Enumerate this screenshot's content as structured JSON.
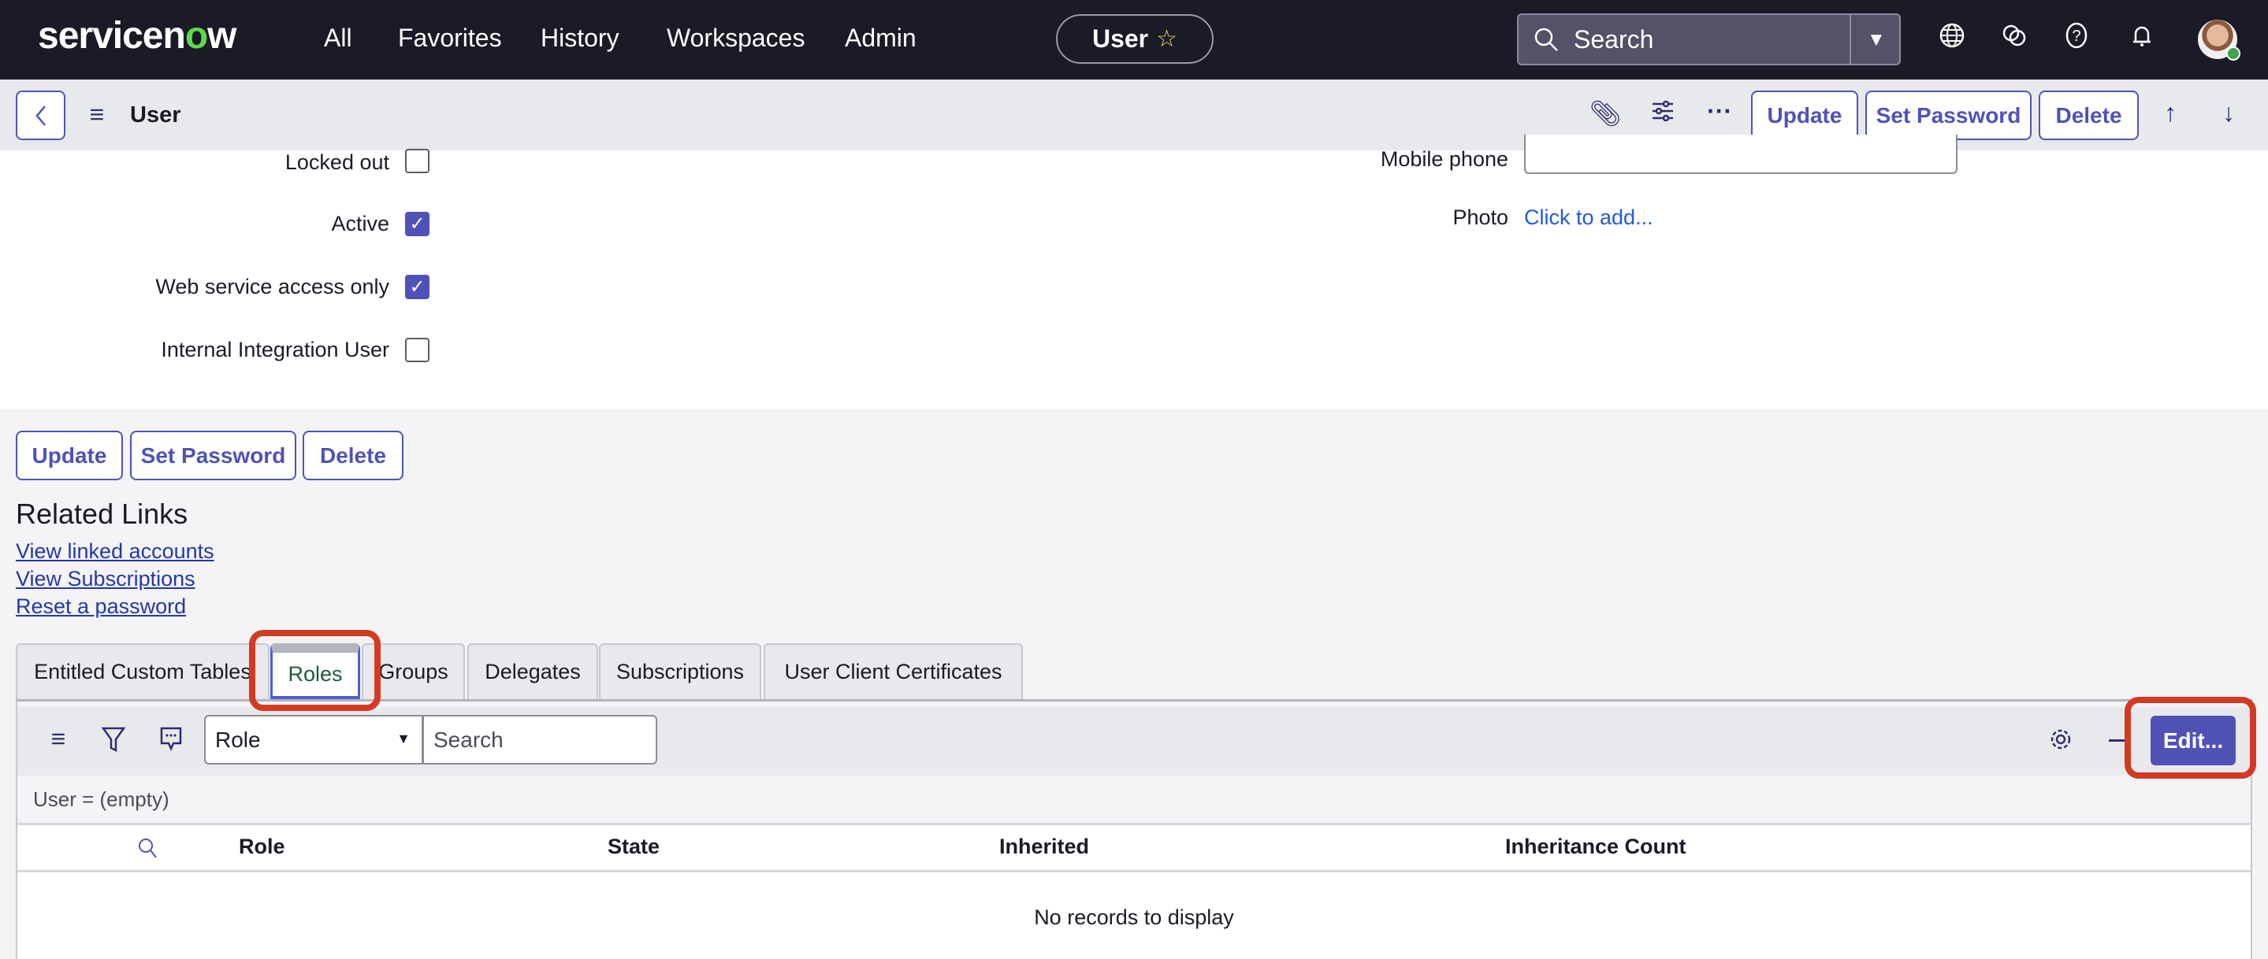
{
  "header": {
    "logo": {
      "pre": "servicen",
      "o": "o",
      "post": "w"
    },
    "nav": [
      "All",
      "Favorites",
      "History",
      "Workspaces",
      "Admin"
    ],
    "context_pill": "User",
    "search_placeholder": "Search",
    "icons": [
      "globe-icon",
      "chat-icon",
      "help-icon",
      "bell-icon",
      "avatar"
    ]
  },
  "form_header": {
    "title": "User",
    "buttons": {
      "update": "Update",
      "set_password": "Set Password",
      "delete": "Delete"
    }
  },
  "form": {
    "checkboxes": [
      {
        "label": "Locked out",
        "checked": false
      },
      {
        "label": "Active",
        "checked": true
      },
      {
        "label": "Web service access only",
        "checked": true
      },
      {
        "label": "Internal Integration User",
        "checked": false
      }
    ],
    "mobile_phone_label": "Mobile phone",
    "mobile_phone_value": "",
    "photo_label": "Photo",
    "photo_link": "Click to add..."
  },
  "bottom_buttons": {
    "update": "Update",
    "set_password": "Set Password",
    "delete": "Delete"
  },
  "related_links": {
    "title": "Related Links",
    "links": [
      "View linked accounts",
      "View Subscriptions",
      "Reset a password"
    ]
  },
  "tabs": [
    "Entitled Custom Tables",
    "Roles",
    "Groups",
    "Delegates",
    "Subscriptions",
    "User Client Certificates"
  ],
  "active_tab": "Roles",
  "list": {
    "search_field": "Role",
    "search_placeholder": "Search",
    "edit_button": "Edit...",
    "breadcrumb": "User = (empty)",
    "columns": [
      "Role",
      "State",
      "Inherited",
      "Inheritance Count"
    ],
    "empty_message": "No records to display"
  },
  "colors": {
    "accent": "#5052b5",
    "topbar": "#1a1b26",
    "highlight": "#d33a22",
    "link": "#1f5ae0"
  }
}
